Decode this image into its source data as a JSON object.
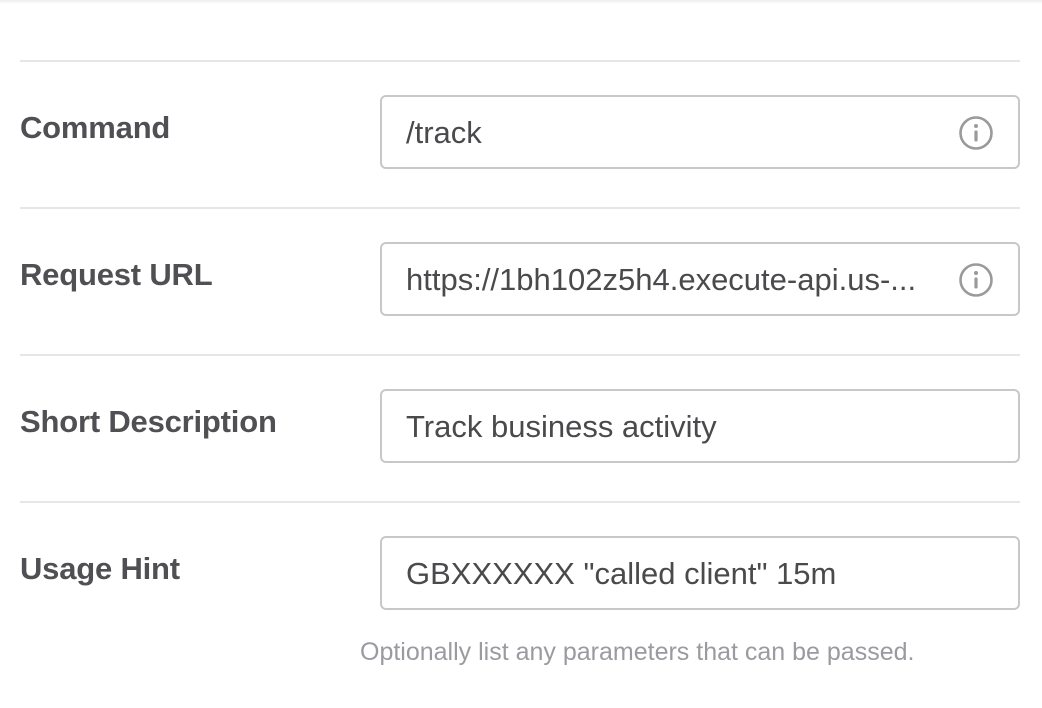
{
  "form": {
    "rows": [
      {
        "label": "Command",
        "value": "/track",
        "icon": "info-icon"
      },
      {
        "label": "Request URL",
        "value": "https://1bh102z5h4.execute-api.us-...",
        "icon": "info-icon"
      },
      {
        "label": "Short Description",
        "value": "Track business activity"
      },
      {
        "label": "Usage Hint",
        "value": "GBXXXXXX \"called client\" 15m"
      }
    ],
    "usage_hint_help": "Optionally list any parameters that can be passed."
  },
  "colors": {
    "label": "#505054",
    "field_border": "#c8c8c8",
    "divider": "#e6e6e6",
    "helper_text": "#9a9aa0",
    "icon": "#9a9a9a"
  }
}
